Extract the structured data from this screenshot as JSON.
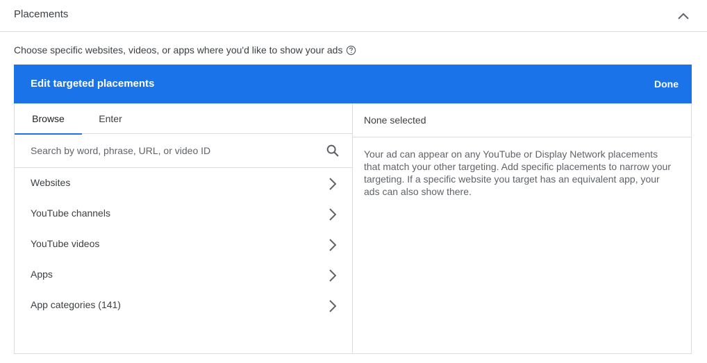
{
  "section": {
    "title": "Placements",
    "collapse_icon": "chevron-up-icon"
  },
  "description": {
    "text": "Choose specific websites, videos, or apps where you'd like to show your ads",
    "help_icon": "help-icon"
  },
  "panel": {
    "title": "Edit targeted placements",
    "done_label": "Done",
    "accent_color": "#1a73e8"
  },
  "tabs": [
    {
      "label": "Browse",
      "active": true
    },
    {
      "label": "Enter",
      "active": false
    }
  ],
  "search": {
    "placeholder": "Search by word, phrase, URL, or video ID",
    "value": "",
    "icon": "search-icon"
  },
  "categories": [
    {
      "label": "Websites"
    },
    {
      "label": "YouTube channels"
    },
    {
      "label": "YouTube videos"
    },
    {
      "label": "Apps"
    },
    {
      "label": "App categories (141)"
    }
  ],
  "selection": {
    "title": "None selected",
    "info": "Your ad can appear on any YouTube or Display Network placements that match your other targeting. Add specific placements to narrow your targeting. If a specific website you target has an equivalent app, your ads can also show there."
  }
}
